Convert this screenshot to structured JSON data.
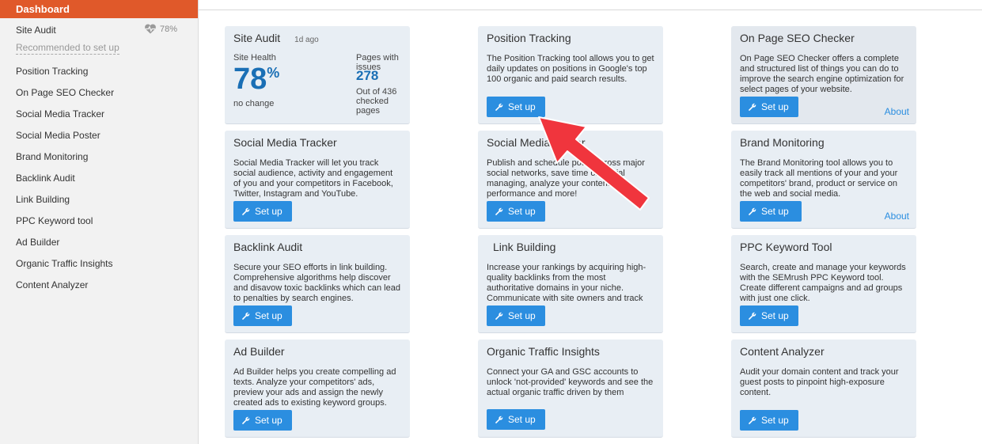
{
  "sidebar": {
    "active": "Dashboard",
    "site_audit": {
      "label": "Site Audit",
      "health": "78%"
    },
    "recommended": "Recommended to set up",
    "items": [
      "Position Tracking",
      "On Page SEO Checker",
      "Social Media Tracker",
      "Social Media Poster",
      "Brand Monitoring",
      "Backlink Audit",
      "Link Building",
      "PPC Keyword tool",
      "Ad Builder",
      "Organic Traffic Insights",
      "Content Analyzer"
    ]
  },
  "site_audit_card": {
    "title": "Site Audit",
    "date": "1d ago",
    "health_label": "Site Health",
    "health_value": "78",
    "health_unit": "%",
    "change": "no change",
    "issues_label": "Pages with issues",
    "issues_value": "278",
    "issues_sub": "Out of 436 checked pages"
  },
  "cards": [
    {
      "title": "Position Tracking",
      "desc": "The Position Tracking tool allows you to get daily updates on positions in Google's top 100 organic and paid search results.",
      "button": "Set up",
      "about": ""
    },
    {
      "title": "On Page SEO Checker",
      "desc": "On Page SEO Checker offers a complete and structured list of things you can do to improve the search engine optimization for select pages of your website.",
      "button": "Set up",
      "about": "About"
    },
    {
      "title": "Social Media Tracker",
      "desc": "Social Media Tracker will let you track social audience, activity and engagement of you and your competitors in Facebook, Twitter, Instagram and YouTube.",
      "button": "Set up",
      "about": ""
    },
    {
      "title": "Social Media Poster",
      "desc": "Publish and schedule posts across major social networks, save time on social managing, analyze your content performance and more!",
      "button": "Set up",
      "about": ""
    },
    {
      "title": "Brand Monitoring",
      "desc": "The Brand Monitoring tool allows you to easily track all mentions of your and your competitors' brand, product or service on the web and social media.",
      "button": "Set up",
      "about": "About"
    },
    {
      "title": "Backlink Audit",
      "desc": "Secure your SEO efforts in link building. Comprehensive algorithms help discover and disavow toxic backlinks which can lead to penalties by search engines.",
      "button": "Set up",
      "about": ""
    },
    {
      "title": "Link Building",
      "desc": "Increase your rankings by acquiring high-quality backlinks from the most authoritative domains in your niche. Communicate with site owners and track your progress.",
      "button": "Set up",
      "about": ""
    },
    {
      "title": "PPC Keyword Tool",
      "desc": "Search, create and manage your keywords with the SEMrush PPC Keyword tool. Create different campaigns and ad groups with just one click.",
      "button": "Set up",
      "about": ""
    },
    {
      "title": "Ad Builder",
      "desc": "Ad Builder helps you create compelling ad texts. Analyze your competitors' ads, preview your ads and assign the newly created ads to existing keyword groups.",
      "button": "Set up",
      "about": ""
    },
    {
      "title": "Organic Traffic Insights",
      "desc": "Connect your GA and GSC accounts to unlock 'not-provided' keywords and see the actual organic traffic driven by them",
      "button": "Set up",
      "about": ""
    },
    {
      "title": "Content Analyzer",
      "desc": "Audit your domain content and track your guest posts to pinpoint high-exposure content.",
      "button": "Set up",
      "about": ""
    }
  ],
  "colors": {
    "accent": "#e0592a",
    "button": "#2b8ee0",
    "card": "#e8eef4",
    "arrow": "#f0353d"
  }
}
